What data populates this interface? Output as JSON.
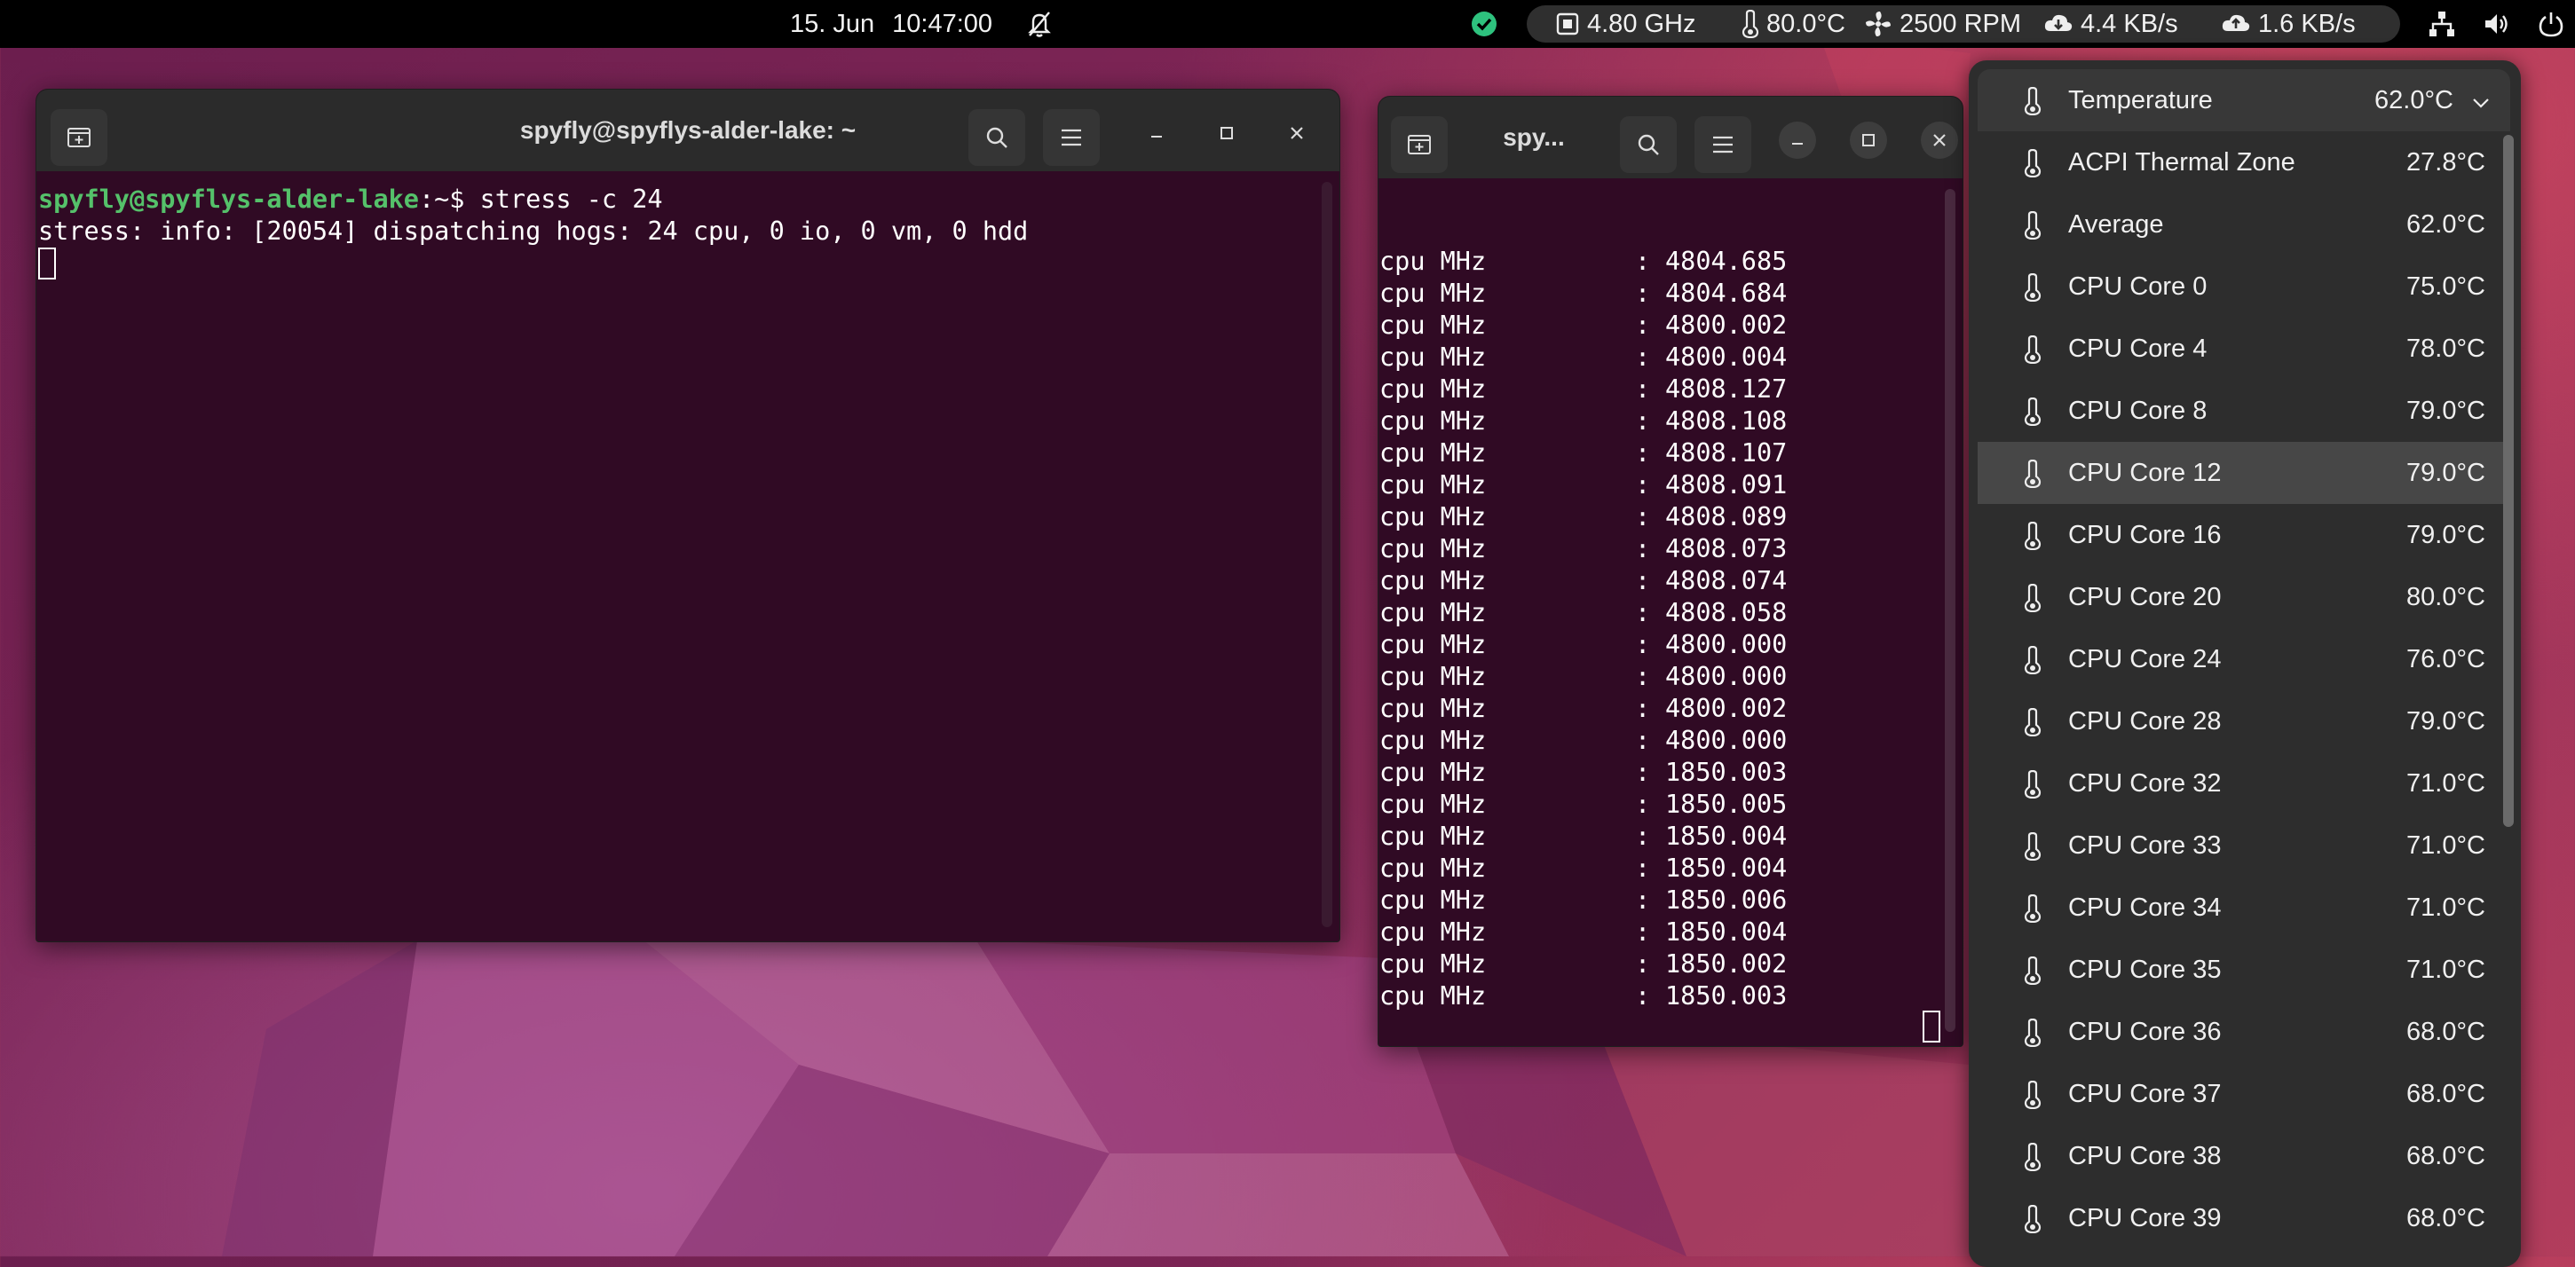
{
  "topbar": {
    "date": "15. Jun",
    "time": "10:47:00",
    "monitor": {
      "cpu_freq": "4.80 GHz",
      "temperature": "80.0°C",
      "fan": "2500 RPM",
      "net_down": "4.4 KB/s",
      "net_up": "1.6 KB/s"
    }
  },
  "terminal1": {
    "title": "spyfly@spyflys-alder-lake: ~",
    "prompt_user": "spyfly@spyflys-alder-lake",
    "prompt_sep": ":~$ ",
    "command": "stress -c 24",
    "output": "stress: info: [20054] dispatching hogs: 24 cpu, 0 io, 0 vm, 0 hdd"
  },
  "terminal2": {
    "title": "spy...",
    "label": "cpu MHz",
    "colon": ":",
    "values": [
      "4804.685",
      "4804.684",
      "4800.002",
      "4800.004",
      "4808.127",
      "4808.108",
      "4808.107",
      "4808.091",
      "4808.089",
      "4808.073",
      "4808.074",
      "4808.058",
      "4800.000",
      "4800.000",
      "4800.002",
      "4800.000",
      "1850.003",
      "1850.005",
      "1850.004",
      "1850.004",
      "1850.006",
      "1850.004",
      "1850.002",
      "1850.003"
    ]
  },
  "temp_menu": {
    "header": {
      "label": "Temperature",
      "value": "62.0°C"
    },
    "items": [
      {
        "label": "ACPI Thermal Zone",
        "value": "27.8°C"
      },
      {
        "label": "Average",
        "value": "62.0°C"
      },
      {
        "label": "CPU Core 0",
        "value": "75.0°C"
      },
      {
        "label": "CPU Core 4",
        "value": "78.0°C"
      },
      {
        "label": "CPU Core 8",
        "value": "79.0°C"
      },
      {
        "label": "CPU Core 12",
        "value": "79.0°C"
      },
      {
        "label": "CPU Core 16",
        "value": "79.0°C"
      },
      {
        "label": "CPU Core 20",
        "value": "80.0°C"
      },
      {
        "label": "CPU Core 24",
        "value": "76.0°C"
      },
      {
        "label": "CPU Core 28",
        "value": "79.0°C"
      },
      {
        "label": "CPU Core 32",
        "value": "71.0°C"
      },
      {
        "label": "CPU Core 33",
        "value": "71.0°C"
      },
      {
        "label": "CPU Core 34",
        "value": "71.0°C"
      },
      {
        "label": "CPU Core 35",
        "value": "71.0°C"
      },
      {
        "label": "CPU Core 36",
        "value": "68.0°C"
      },
      {
        "label": "CPU Core 37",
        "value": "68.0°C"
      },
      {
        "label": "CPU Core 38",
        "value": "68.0°C"
      },
      {
        "label": "CPU Core 39",
        "value": "68.0°C"
      }
    ]
  }
}
